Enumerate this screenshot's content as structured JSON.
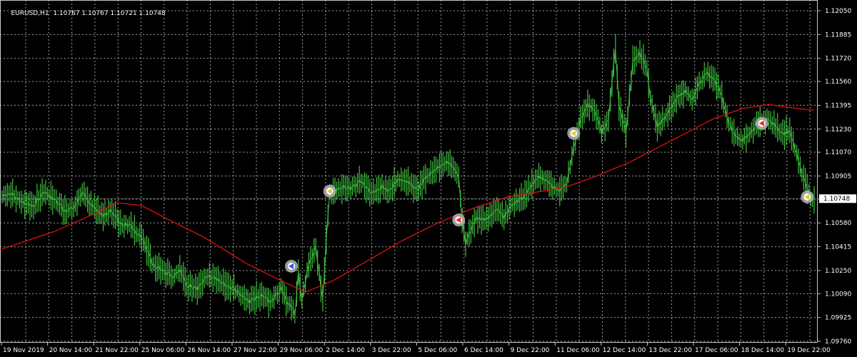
{
  "header": {
    "symbol": "EURUSD,H1",
    "ohlc": "1.10767 1.10767 1.10721 1.10748"
  },
  "colors": {
    "background": "#000000",
    "grid": "#c8c8c8",
    "candle": "#3fbf3f",
    "moving_average": "#e01010",
    "last_price_line": "#7f8fa8",
    "marker_ring": "#b4b4b4"
  },
  "price_label": {
    "value": "1.10748"
  },
  "chart_data": {
    "type": "line",
    "title": "EURUSD,H1",
    "ylim": [
      1.0976,
      1.1205
    ],
    "y_ticks": [
      "1.12050",
      "1.11885",
      "1.11720",
      "1.11560",
      "1.11395",
      "1.11230",
      "1.11070",
      "1.10905",
      "1.10745",
      "1.10580",
      "1.10415",
      "1.10250",
      "1.10090",
      "1.09925",
      "1.09760"
    ],
    "x_ticks": [
      "19 Nov 2019",
      "20 Nov 14:00",
      "21 Nov 22:00",
      "25 Nov 06:00",
      "26 Nov 14:00",
      "27 Nov 22:00",
      "29 Nov 06:00",
      "2 Dec 14:00",
      "3 Dec 22:00",
      "5 Dec 06:00",
      "6 Dec 14:00",
      "9 Dec 22:00",
      "11 Dec 06:00",
      "12 Dec 14:00",
      "13 Dec 22:00",
      "17 Dec 06:00",
      "18 Dec 14:00",
      "19 Dec 22:00"
    ],
    "grid": true,
    "series": [
      {
        "kind": "price",
        "points": [
          [
            0,
            1.1076
          ],
          [
            3,
            1.1078
          ],
          [
            6,
            1.1072
          ],
          [
            9,
            1.107
          ],
          [
            12,
            1.108
          ],
          [
            15,
            1.1074
          ],
          [
            18,
            1.1066
          ],
          [
            21,
            1.107
          ],
          [
            23,
            1.108
          ],
          [
            25,
            1.1072
          ],
          [
            27,
            1.1068
          ],
          [
            29,
            1.1063
          ],
          [
            31,
            1.1066
          ],
          [
            34,
            1.1058
          ],
          [
            37,
            1.1055
          ],
          [
            40,
            1.1048
          ],
          [
            43,
            1.103
          ],
          [
            46,
            1.1025
          ],
          [
            49,
            1.102
          ],
          [
            51,
            1.1026
          ],
          [
            53,
            1.1015
          ],
          [
            56,
            1.1012
          ],
          [
            59,
            1.1022
          ],
          [
            62,
            1.1018
          ],
          [
            65,
            1.1014
          ],
          [
            68,
            1.101
          ],
          [
            71,
            1.1003
          ],
          [
            74,
            1.1008
          ],
          [
            77,
            1.1003
          ],
          [
            80,
            1.1013
          ],
          [
            82,
            1.1003
          ],
          [
            84,
            1.0995
          ],
          [
            85,
            1.1025
          ],
          [
            86,
            1.1005
          ],
          [
            88,
            1.103
          ],
          [
            90,
            1.104
          ],
          [
            92,
            1.1005
          ],
          [
            93,
            1.1045
          ],
          [
            94,
            1.1078
          ],
          [
            97,
            1.1083
          ],
          [
            100,
            1.1082
          ],
          [
            103,
            1.1087
          ],
          [
            106,
            1.1078
          ],
          [
            109,
            1.1083
          ],
          [
            111,
            1.108
          ],
          [
            113,
            1.1087
          ],
          [
            115,
            1.1088
          ],
          [
            117,
            1.1085
          ],
          [
            119,
            1.108
          ],
          [
            121,
            1.1088
          ],
          [
            123,
            1.1093
          ],
          [
            125,
            1.1096
          ],
          [
            127,
            1.11
          ],
          [
            129,
            1.1098
          ],
          [
            131,
            1.109
          ],
          [
            132,
            1.106
          ],
          [
            133,
            1.1045
          ],
          [
            134,
            1.105
          ],
          [
            136,
            1.1062
          ],
          [
            138,
            1.106
          ],
          [
            140,
            1.1063
          ],
          [
            142,
            1.1068
          ],
          [
            144,
            1.1062
          ],
          [
            146,
            1.107
          ],
          [
            148,
            1.1073
          ],
          [
            150,
            1.1076
          ],
          [
            152,
            1.1085
          ],
          [
            154,
            1.109
          ],
          [
            156,
            1.1088
          ],
          [
            158,
            1.1083
          ],
          [
            160,
            1.108
          ],
          [
            162,
            1.1086
          ],
          [
            164,
            1.111
          ],
          [
            166,
            1.113
          ],
          [
            168,
            1.114
          ],
          [
            170,
            1.1136
          ],
          [
            172,
            1.112
          ],
          [
            174,
            1.113
          ],
          [
            176,
            1.118
          ],
          [
            177,
            1.114
          ],
          [
            179,
            1.112
          ],
          [
            181,
            1.117
          ],
          [
            183,
            1.1175
          ],
          [
            185,
            1.1165
          ],
          [
            186,
            1.1145
          ],
          [
            188,
            1.1125
          ],
          [
            190,
            1.113
          ],
          [
            192,
            1.1138
          ],
          [
            194,
            1.1145
          ],
          [
            196,
            1.115
          ],
          [
            198,
            1.1143
          ],
          [
            200,
            1.1155
          ],
          [
            202,
            1.1162
          ],
          [
            204,
            1.1158
          ],
          [
            206,
            1.115
          ],
          [
            208,
            1.113
          ],
          [
            210,
            1.112
          ],
          [
            212,
            1.1115
          ],
          [
            214,
            1.1118
          ],
          [
            216,
            1.1125
          ],
          [
            218,
            1.1128
          ],
          [
            220,
            1.113
          ],
          [
            222,
            1.1125
          ],
          [
            224,
            1.112
          ],
          [
            226,
            1.1122
          ],
          [
            228,
            1.1105
          ],
          [
            230,
            1.1088
          ],
          [
            232,
            1.1075
          ],
          [
            233,
            1.1074
          ]
        ]
      },
      {
        "kind": "moving_average",
        "points": [
          [
            0,
            1.104
          ],
          [
            15,
            1.1052
          ],
          [
            28,
            1.1066
          ],
          [
            33,
            1.1072
          ],
          [
            40,
            1.107
          ],
          [
            48,
            1.106
          ],
          [
            58,
            1.1048
          ],
          [
            70,
            1.103
          ],
          [
            80,
            1.1018
          ],
          [
            87,
            1.101
          ],
          [
            95,
            1.1018
          ],
          [
            105,
            1.1032
          ],
          [
            115,
            1.1046
          ],
          [
            125,
            1.1058
          ],
          [
            135,
            1.1068
          ],
          [
            145,
            1.1076
          ],
          [
            155,
            1.108
          ],
          [
            162,
            1.1083
          ],
          [
            170,
            1.109
          ],
          [
            180,
            1.11
          ],
          [
            188,
            1.111
          ],
          [
            196,
            1.112
          ],
          [
            204,
            1.113
          ],
          [
            212,
            1.1137
          ],
          [
            220,
            1.114
          ],
          [
            226,
            1.1138
          ],
          [
            233,
            1.1136
          ]
        ]
      }
    ],
    "markers": [
      {
        "x": 83,
        "y": 1.1028,
        "arrow": "blue"
      },
      {
        "x": 94,
        "y": 1.108,
        "arrow": "yellow"
      },
      {
        "x": 131,
        "y": 1.106,
        "arrow": "red"
      },
      {
        "x": 164,
        "y": 1.112,
        "arrow": "yellow"
      },
      {
        "x": 218,
        "y": 1.1127,
        "arrow": "red"
      },
      {
        "x": 231,
        "y": 1.1076,
        "arrow": "yellow"
      }
    ],
    "last_price": 1.10748
  }
}
